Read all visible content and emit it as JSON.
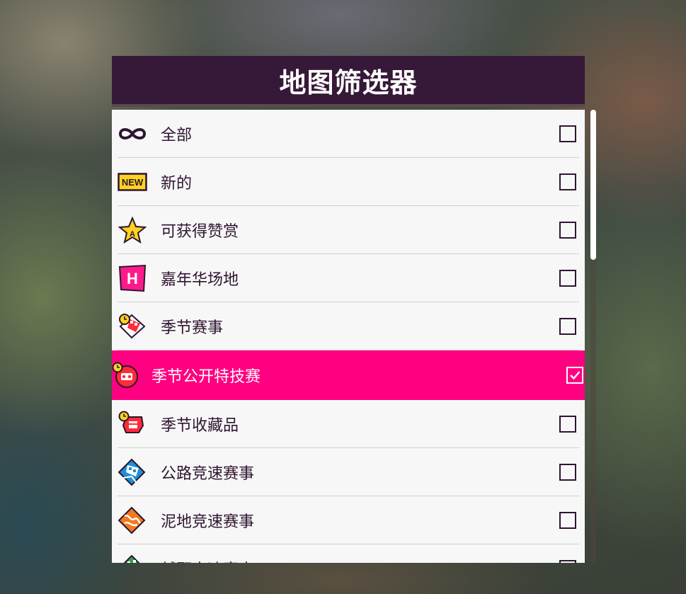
{
  "header": {
    "title": "地图筛选器"
  },
  "filters": [
    {
      "label": "全部",
      "icon": "infinity-icon",
      "checked": false
    },
    {
      "label": "新的",
      "icon": "new-badge-icon",
      "checked": false
    },
    {
      "label": "可获得赞赏",
      "icon": "star-accolade-icon",
      "checked": false
    },
    {
      "label": "嘉年华场地",
      "icon": "festival-site-icon",
      "checked": false
    },
    {
      "label": "季节赛事",
      "icon": "seasonal-event-icon",
      "checked": false
    },
    {
      "label": "季节公开特技赛",
      "icon": "seasonal-stunt-icon",
      "checked": true
    },
    {
      "label": "季节收藏品",
      "icon": "seasonal-collectible-icon",
      "checked": false
    },
    {
      "label": "公路竞速赛事",
      "icon": "road-racing-icon",
      "checked": false
    },
    {
      "label": "泥地竞速赛事",
      "icon": "dirt-racing-icon",
      "checked": false
    },
    {
      "label": "越野竞速赛事",
      "icon": "cross-country-icon",
      "checked": false
    }
  ],
  "colors": {
    "header_bg": "#361838",
    "row_bg": "#f7f7f7",
    "selected_bg": "#ff0080",
    "text_dark": "#2e1530"
  }
}
